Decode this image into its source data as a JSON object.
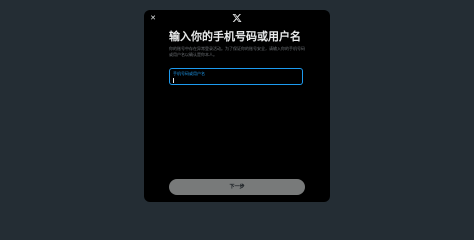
{
  "modal": {
    "close_glyph": "✕",
    "logo_icon": "x-logo-icon",
    "title": "输入你的手机号码或用户名",
    "subtitle": "你的账号中存在异常登录活动。为了保证你的账号安全，请输入你的手机号码或用户名以确认是你本人。",
    "input": {
      "label": "手机号码或用户名",
      "value": ""
    },
    "next_button_label": "下一步"
  },
  "colors": {
    "backdrop": "#242d34",
    "modal": "#000000",
    "accent": "#1d9bf0",
    "button": "#787a7a"
  }
}
